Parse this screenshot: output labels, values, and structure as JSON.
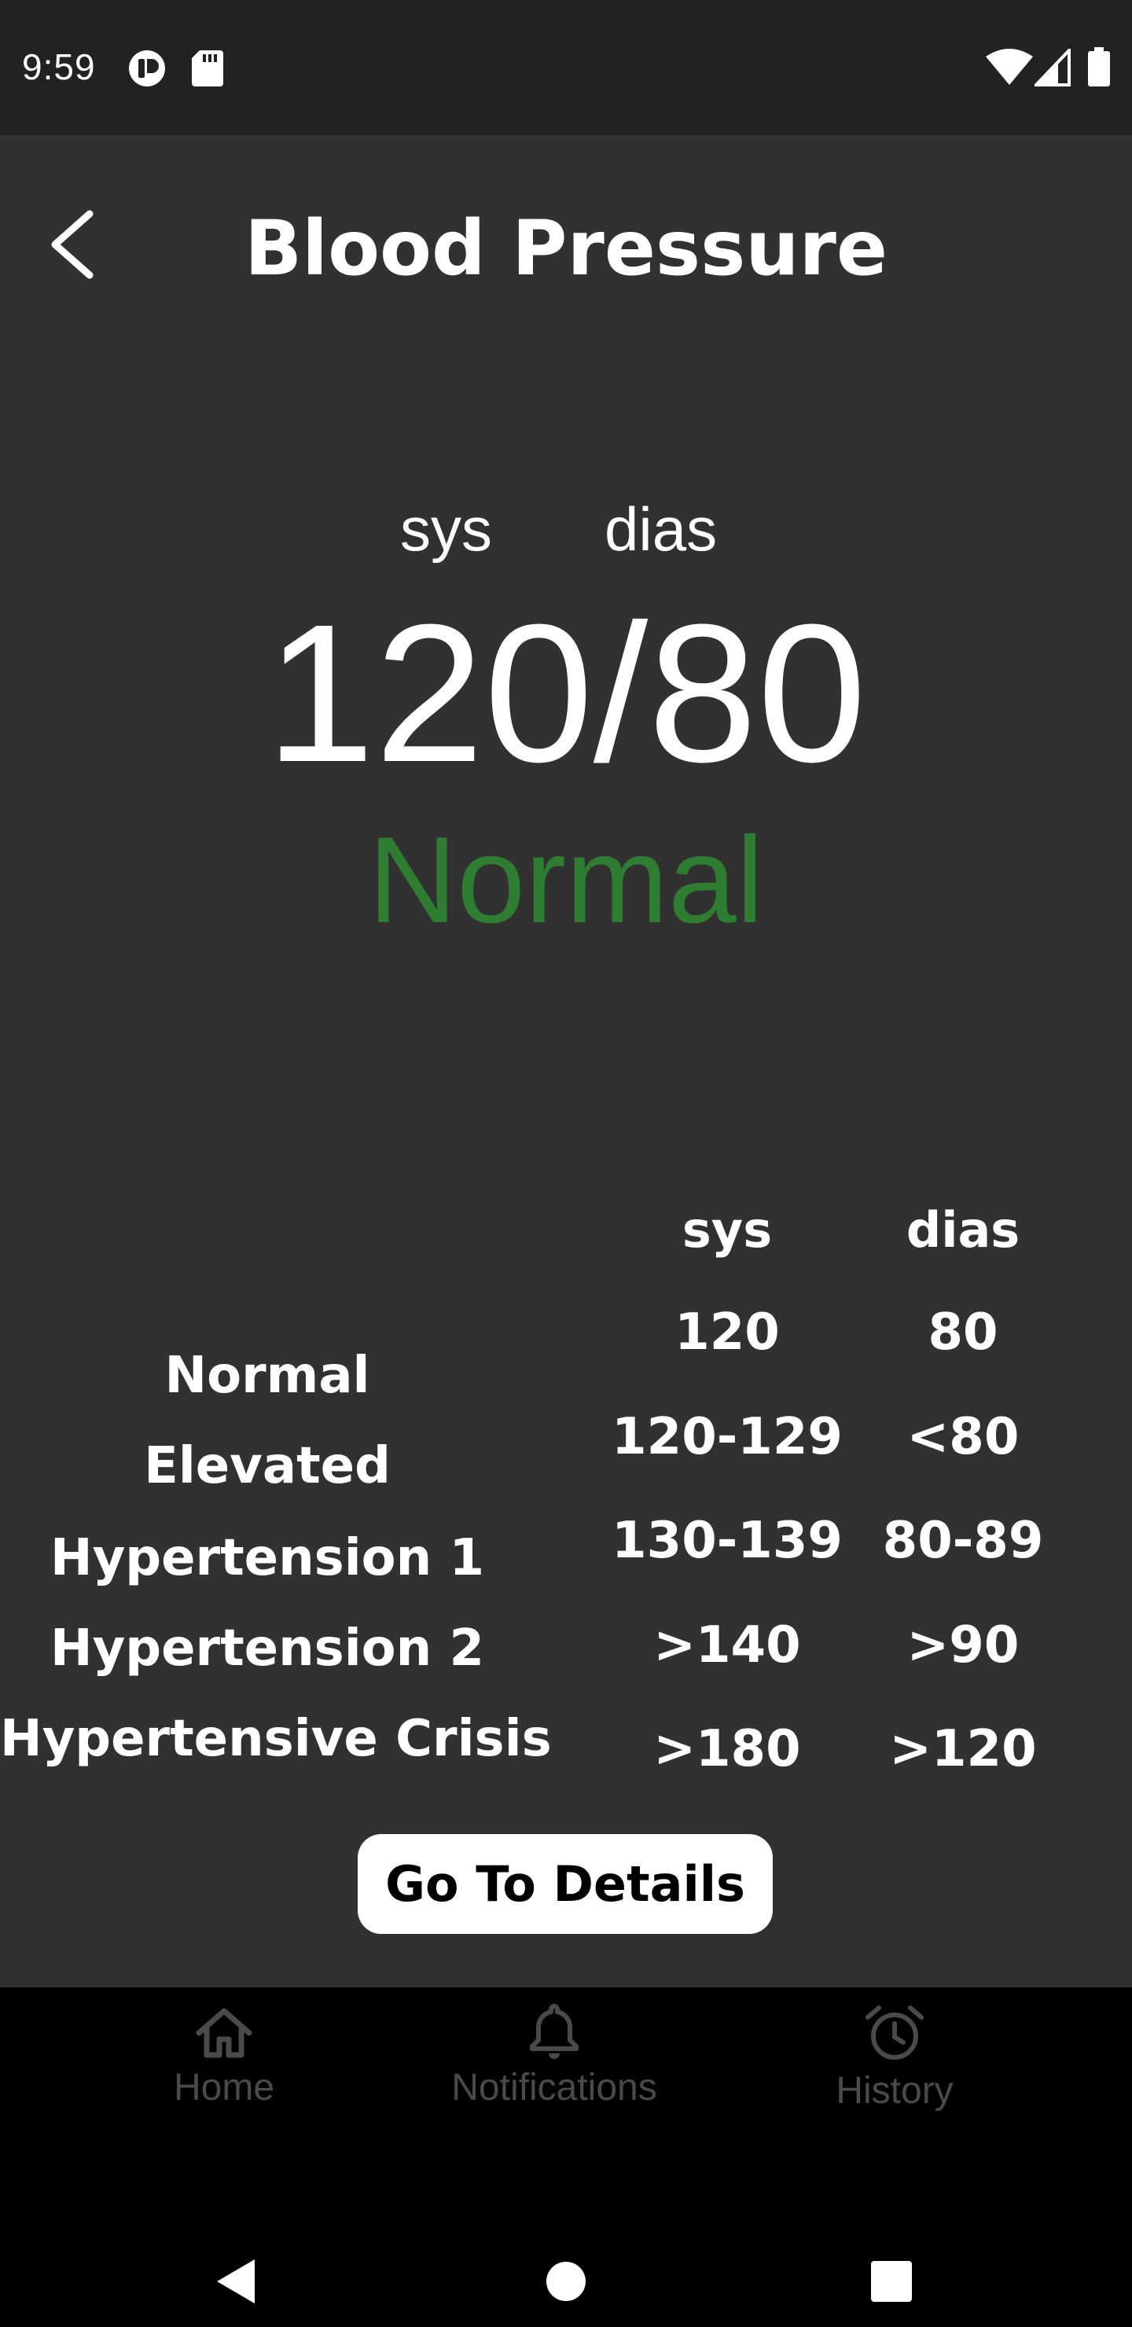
{
  "status_bar": {
    "time": "9:59",
    "icons": [
      "app-notification-icon",
      "sd-card-icon",
      "wifi-icon",
      "signal-icon",
      "battery-icon"
    ]
  },
  "header": {
    "title": "Blood Pressure",
    "back_icon": "chevron-left-icon"
  },
  "reading": {
    "sys_label": "sys",
    "dias_label": "dias",
    "value": "120/80",
    "status": "Normal",
    "status_color": "#2e7d32"
  },
  "table": {
    "headers": [
      "sys",
      "dias"
    ],
    "rows": [
      {
        "label": "Normal",
        "sys": "120",
        "dias": "80"
      },
      {
        "label": "Elevated",
        "sys": "120-129",
        "dias": "<80"
      },
      {
        "label": "Hypertension 1",
        "sys": "130-139",
        "dias": "80-89"
      },
      {
        "label": "Hypertension 2",
        "sys": ">140",
        "dias": ">90"
      },
      {
        "label": "Hypertensive Crisis",
        "sys": ">180",
        "dias": ">120"
      }
    ]
  },
  "button": {
    "label": "Go To Details"
  },
  "bottom_nav": {
    "items": [
      {
        "label": "Home",
        "icon": "home-icon"
      },
      {
        "label": "Notifications",
        "icon": "bell-icon"
      },
      {
        "label": "History",
        "icon": "alarm-clock-icon"
      }
    ]
  },
  "system_nav": {
    "icons": [
      "back-triangle-icon",
      "home-circle-icon",
      "recents-square-icon"
    ]
  },
  "colors": {
    "background": "#313131",
    "status_bar": "#222222",
    "bottom_nav": "#000000",
    "nav_inactive": "#4a4a4a",
    "accent_green": "#2e7d32"
  }
}
